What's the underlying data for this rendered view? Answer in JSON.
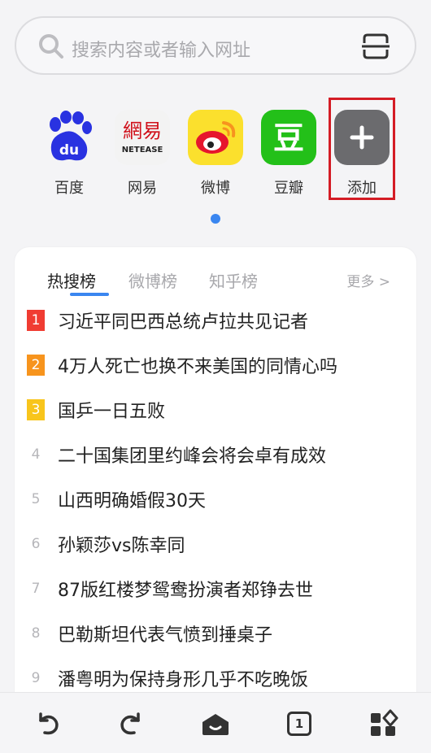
{
  "search": {
    "placeholder": "搜索内容或者输入网址",
    "search_icon": "search-icon",
    "scan_icon": "scan-icon"
  },
  "shortcuts": [
    {
      "label": "百度",
      "icon": "baidu-logo",
      "color": "#2932e1"
    },
    {
      "label": "网易",
      "icon": "netease-logo",
      "color": "#d0111b",
      "logo_text": "網易",
      "logo_sub": "NETEASE"
    },
    {
      "label": "微博",
      "icon": "weibo-logo",
      "color": "#e6162d"
    },
    {
      "label": "豆瓣",
      "icon": "douban-logo",
      "color": "#23c019",
      "logo_text": "豆"
    },
    {
      "label": "添加",
      "icon": "plus-icon",
      "color": "#6b6b6e"
    }
  ],
  "hot": {
    "tabs": [
      "热搜榜",
      "微博榜",
      "知乎榜"
    ],
    "active_tab": "热搜榜",
    "more": "更多 >",
    "items": [
      {
        "rank": "1",
        "text": "习近平同巴西总统卢拉共见记者",
        "badge_color": "#f03c32"
      },
      {
        "rank": "2",
        "text": "4万人死亡也换不来美国的同情心吗",
        "badge_color": "#f7941d"
      },
      {
        "rank": "3",
        "text": "国乒一日五败",
        "badge_color": "#f8c51c"
      },
      {
        "rank": "4",
        "text": "二十国集团里约峰会将会卓有成效"
      },
      {
        "rank": "5",
        "text": "山西明确婚假30天"
      },
      {
        "rank": "6",
        "text": "孙颖莎vs陈幸同"
      },
      {
        "rank": "7",
        "text": "87版红楼梦鸳鸯扮演者郑铮去世"
      },
      {
        "rank": "8",
        "text": "巴勒斯坦代表气愤到捶桌子"
      },
      {
        "rank": "9",
        "text": "潘粤明为保持身形几乎不吃晚饭"
      }
    ]
  },
  "bottom_nav": {
    "tab_count": "1",
    "icons": [
      "back-icon",
      "forward-icon",
      "home-icon",
      "tabs-icon",
      "apps-icon"
    ]
  }
}
